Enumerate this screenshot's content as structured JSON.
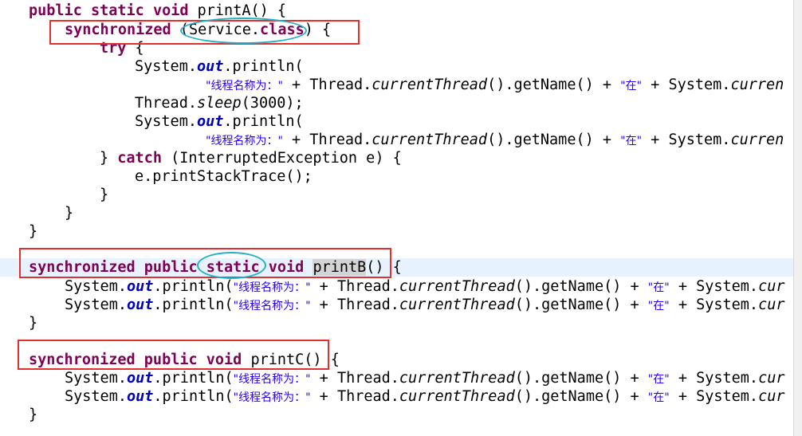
{
  "code": {
    "sig_a": [
      "public",
      "static",
      "void",
      "printA() {"
    ],
    "sync_block": [
      "synchronized",
      "(",
      "Service",
      ".",
      "class",
      ") {"
    ],
    "try": [
      "try",
      " {"
    ],
    "sysout": [
      "System.",
      "out",
      ".println("
    ],
    "str_name_label": "\"线程名称为：\"",
    "plus_thread": " + Thread.",
    "current_thread": "currentThread",
    "get_name": "().getName() + ",
    "str_zai": "\"在\"",
    "plus_system": " + System.",
    "current_trunc": "curren",
    "sleep_line": [
      "Thread.",
      "sleep",
      "(3000);"
    ],
    "catch": [
      "} ",
      "catch",
      " (InterruptedException ",
      "e",
      ") {"
    ],
    "print_stack": [
      "e",
      ".printStackTrace();"
    ],
    "close_brace": "}",
    "sig_b": [
      "synchronized",
      "public",
      "static",
      "void",
      "printB",
      "() {"
    ],
    "sig_c": [
      "synchronized",
      "public",
      "void",
      "printC",
      "() {"
    ],
    "sysout_open": ".println(",
    "trunc_cur": "cur"
  },
  "annotations": {
    "box_color": "#e03131",
    "oval_color": "#20b2c8"
  }
}
